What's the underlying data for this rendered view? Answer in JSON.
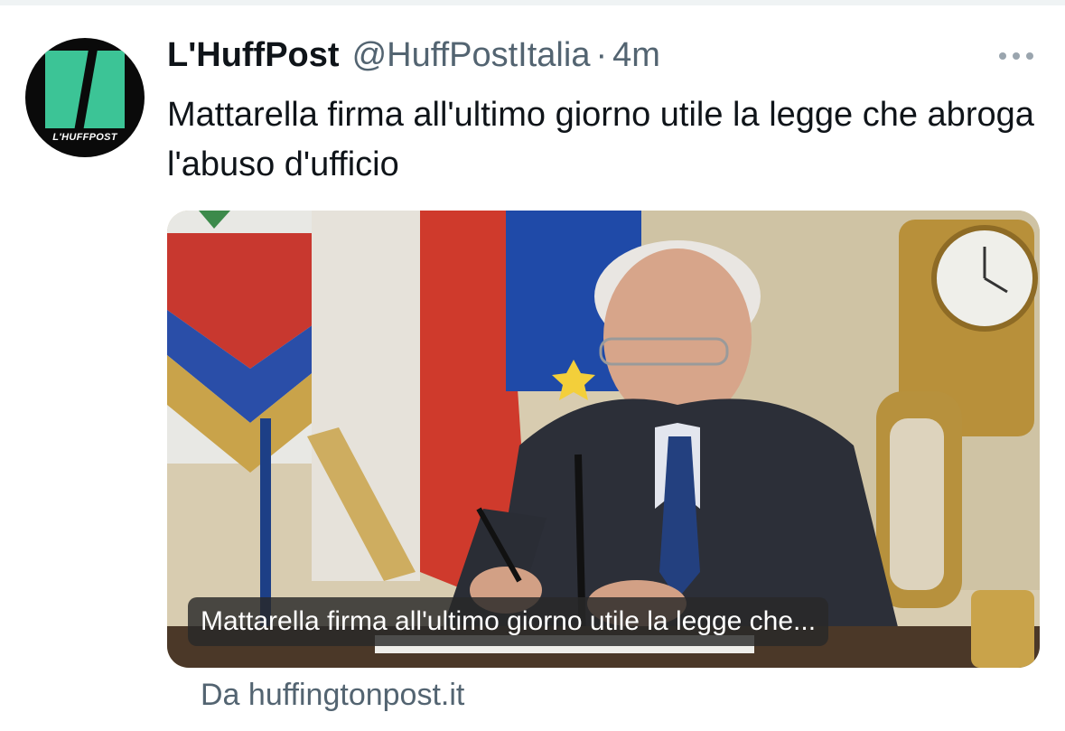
{
  "avatar": {
    "logo_text": "L'HUFFPOST",
    "logo_color": "#3cc496"
  },
  "header": {
    "author_name": "L'HuffPost",
    "handle": "@HuffPostItalia",
    "separator": "·",
    "timestamp": "4m"
  },
  "tweet": {
    "text": "Mattarella firma all'ultimo giorno utile la legge che abroga l'abuso d'ufficio"
  },
  "card": {
    "caption": "Mattarella firma all'ultimo giorno utile la legge che...",
    "source": "Da huffingtonpost.it"
  },
  "icons": {
    "more": "more-options-icon"
  },
  "colors": {
    "text_primary": "#0f1419",
    "text_secondary": "#536471",
    "divider": "#eff3f4"
  }
}
